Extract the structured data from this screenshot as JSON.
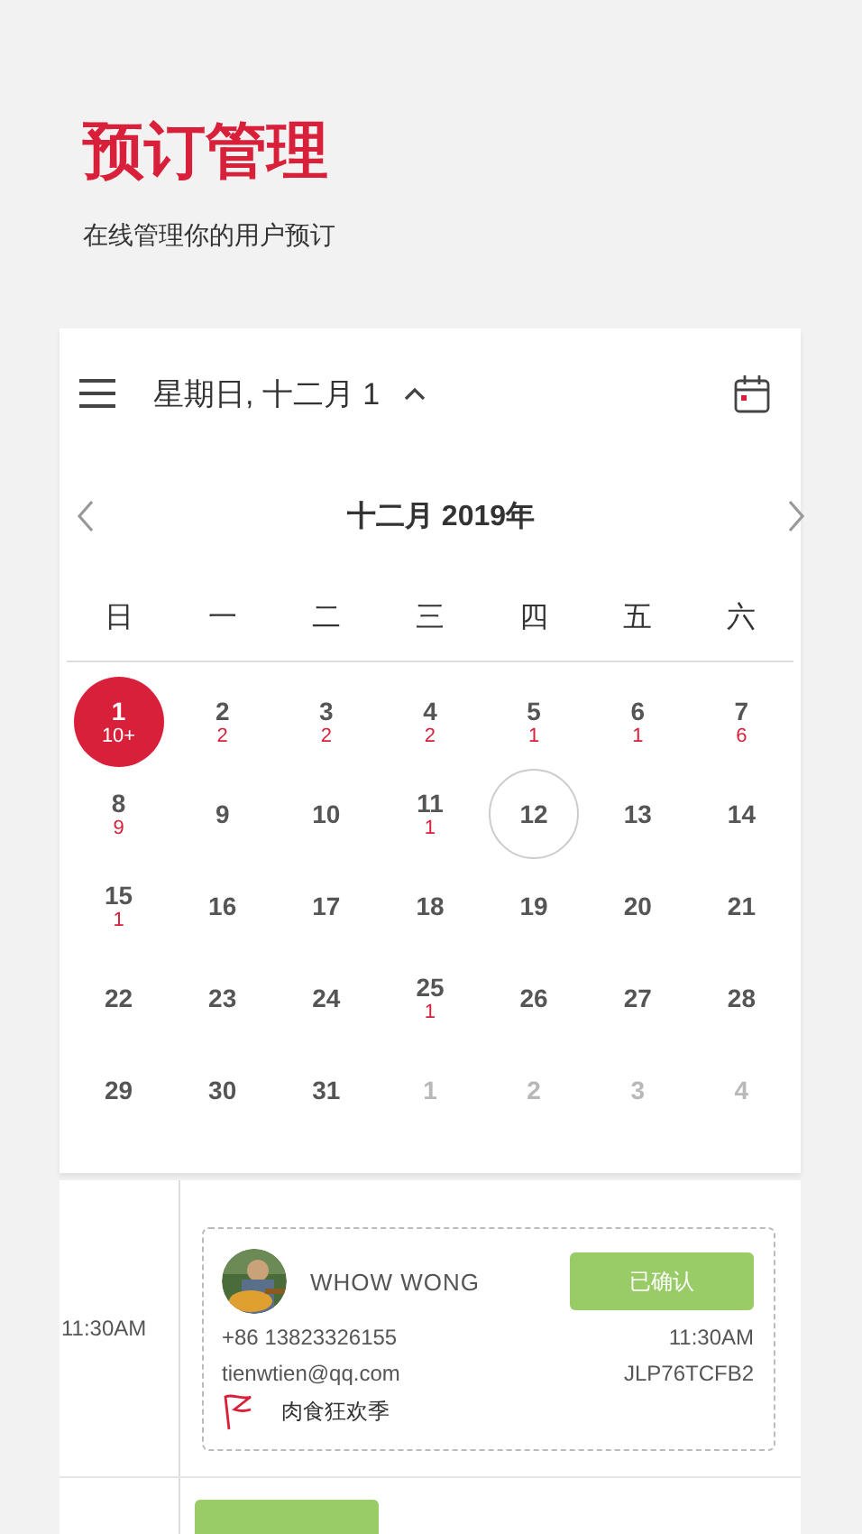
{
  "header": {
    "title": "预订管理",
    "subtitle": "在线管理你的用户预订"
  },
  "calendar": {
    "date_label": "星期日, 十二月 1",
    "expanded": true,
    "month_label": "十二月 2019年",
    "weekdays": [
      "日",
      "一",
      "二",
      "三",
      "四",
      "五",
      "六"
    ],
    "days": [
      {
        "day": "1",
        "count": "10+",
        "selected": true,
        "today": false,
        "other_month": false
      },
      {
        "day": "2",
        "count": "2",
        "selected": false,
        "today": false,
        "other_month": false
      },
      {
        "day": "3",
        "count": "2",
        "selected": false,
        "today": false,
        "other_month": false
      },
      {
        "day": "4",
        "count": "2",
        "selected": false,
        "today": false,
        "other_month": false
      },
      {
        "day": "5",
        "count": "1",
        "selected": false,
        "today": false,
        "other_month": false
      },
      {
        "day": "6",
        "count": "1",
        "selected": false,
        "today": false,
        "other_month": false
      },
      {
        "day": "7",
        "count": "6",
        "selected": false,
        "today": false,
        "other_month": false
      },
      {
        "day": "8",
        "count": "9",
        "selected": false,
        "today": false,
        "other_month": false
      },
      {
        "day": "9",
        "selected": false,
        "today": false,
        "other_month": false
      },
      {
        "day": "10",
        "selected": false,
        "today": false,
        "other_month": false
      },
      {
        "day": "11",
        "count": "1",
        "selected": false,
        "today": false,
        "other_month": false
      },
      {
        "day": "12",
        "selected": false,
        "today": true,
        "other_month": false
      },
      {
        "day": "13",
        "selected": false,
        "today": false,
        "other_month": false
      },
      {
        "day": "14",
        "selected": false,
        "today": false,
        "other_month": false
      },
      {
        "day": "15",
        "count": "1",
        "selected": false,
        "today": false,
        "other_month": false
      },
      {
        "day": "16",
        "selected": false,
        "today": false,
        "other_month": false
      },
      {
        "day": "17",
        "selected": false,
        "today": false,
        "other_month": false
      },
      {
        "day": "18",
        "selected": false,
        "today": false,
        "other_month": false
      },
      {
        "day": "19",
        "selected": false,
        "today": false,
        "other_month": false
      },
      {
        "day": "20",
        "selected": false,
        "today": false,
        "other_month": false
      },
      {
        "day": "21",
        "selected": false,
        "today": false,
        "other_month": false
      },
      {
        "day": "22",
        "selected": false,
        "today": false,
        "other_month": false
      },
      {
        "day": "23",
        "selected": false,
        "today": false,
        "other_month": false
      },
      {
        "day": "24",
        "selected": false,
        "today": false,
        "other_month": false
      },
      {
        "day": "25",
        "count": "1",
        "selected": false,
        "today": false,
        "other_month": false
      },
      {
        "day": "26",
        "selected": false,
        "today": false,
        "other_month": false
      },
      {
        "day": "27",
        "selected": false,
        "today": false,
        "other_month": false
      },
      {
        "day": "28",
        "selected": false,
        "today": false,
        "other_month": false
      },
      {
        "day": "29",
        "selected": false,
        "today": false,
        "other_month": false
      },
      {
        "day": "30",
        "selected": false,
        "today": false,
        "other_month": false
      },
      {
        "day": "31",
        "selected": false,
        "today": false,
        "other_month": false
      },
      {
        "day": "1",
        "selected": false,
        "today": false,
        "other_month": true
      },
      {
        "day": "2",
        "selected": false,
        "today": false,
        "other_month": true
      },
      {
        "day": "3",
        "selected": false,
        "today": false,
        "other_month": true
      },
      {
        "day": "4",
        "selected": false,
        "today": false,
        "other_month": true
      }
    ]
  },
  "bookings": [
    {
      "time": "11:30AM",
      "name": "WHOW WONG",
      "status": "已确认",
      "phone": "+86 13823326155",
      "booked_time": "11:30AM",
      "email": "tienwtien@qq.com",
      "code": "JLP76TCFB2",
      "event": "肉食狂欢季"
    },
    {
      "partial": true
    }
  ]
}
